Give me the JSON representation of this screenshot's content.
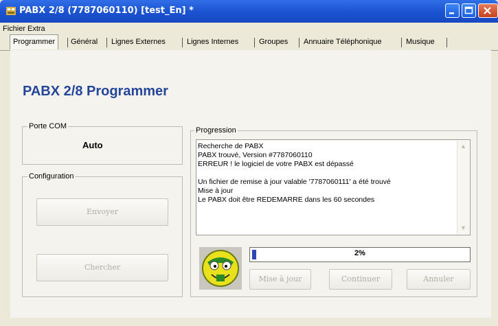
{
  "window": {
    "title": "PABX 2/8 (7787060110) [test_En] *"
  },
  "menubar": {
    "items": [
      "Fichier",
      "Extra"
    ]
  },
  "tabs": [
    "Programmer",
    "Général",
    "Lignes Externes",
    "Lignes Internes",
    "Groupes",
    "Annuaire Téléphonique",
    "Musique"
  ],
  "heading": "PABX 2/8 Programmer",
  "com_port": {
    "label": "Porte COM",
    "value": "Auto"
  },
  "configuration": {
    "label": "Configuration",
    "send_button": "Envoyer",
    "search_button": "Chercher"
  },
  "progression": {
    "label": "Progression",
    "log": [
      "Recherche de PABX",
      "PABX trouvé, Version #7787060110",
      "ERREUR ! le logiciel de votre PABX est dépassé",
      "",
      "Un fichier de remise à jour valable '7787060111' a été trouvé",
      "Mise à jour",
      "Le PABX doit être REDEMARRE dans les 60 secondes"
    ],
    "percent": 2,
    "percent_text": "2%",
    "buttons": {
      "update": "Mise à jour",
      "continue": "Continuer",
      "cancel": "Annuler"
    }
  }
}
